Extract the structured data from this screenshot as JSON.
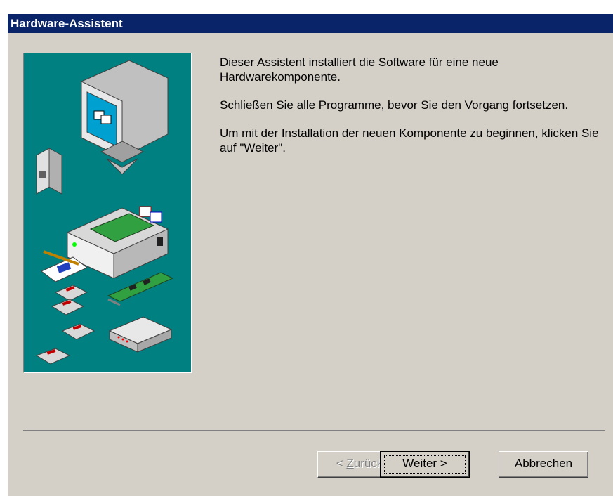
{
  "window": {
    "title": "Hardware-Assistent"
  },
  "content": {
    "paragraph1": "Dieser Assistent installiert die Software für eine neue Hardwarekomponente.",
    "paragraph2": "Schließen Sie alle Programme, bevor Sie den Vorgang fortsetzen.",
    "paragraph3": "Um mit der Installation der neuen Komponente zu beginnen, klicken Sie auf \"Weiter\"."
  },
  "buttons": {
    "back_prefix": "< ",
    "back_hotkey": "Z",
    "back_rest": "urück",
    "next_label": "Weiter >",
    "cancel_label": "Abbrechen"
  },
  "colors": {
    "titlebar": "#0a246a",
    "dialog_bg": "#d4d0c8",
    "art_bg": "#008080"
  }
}
